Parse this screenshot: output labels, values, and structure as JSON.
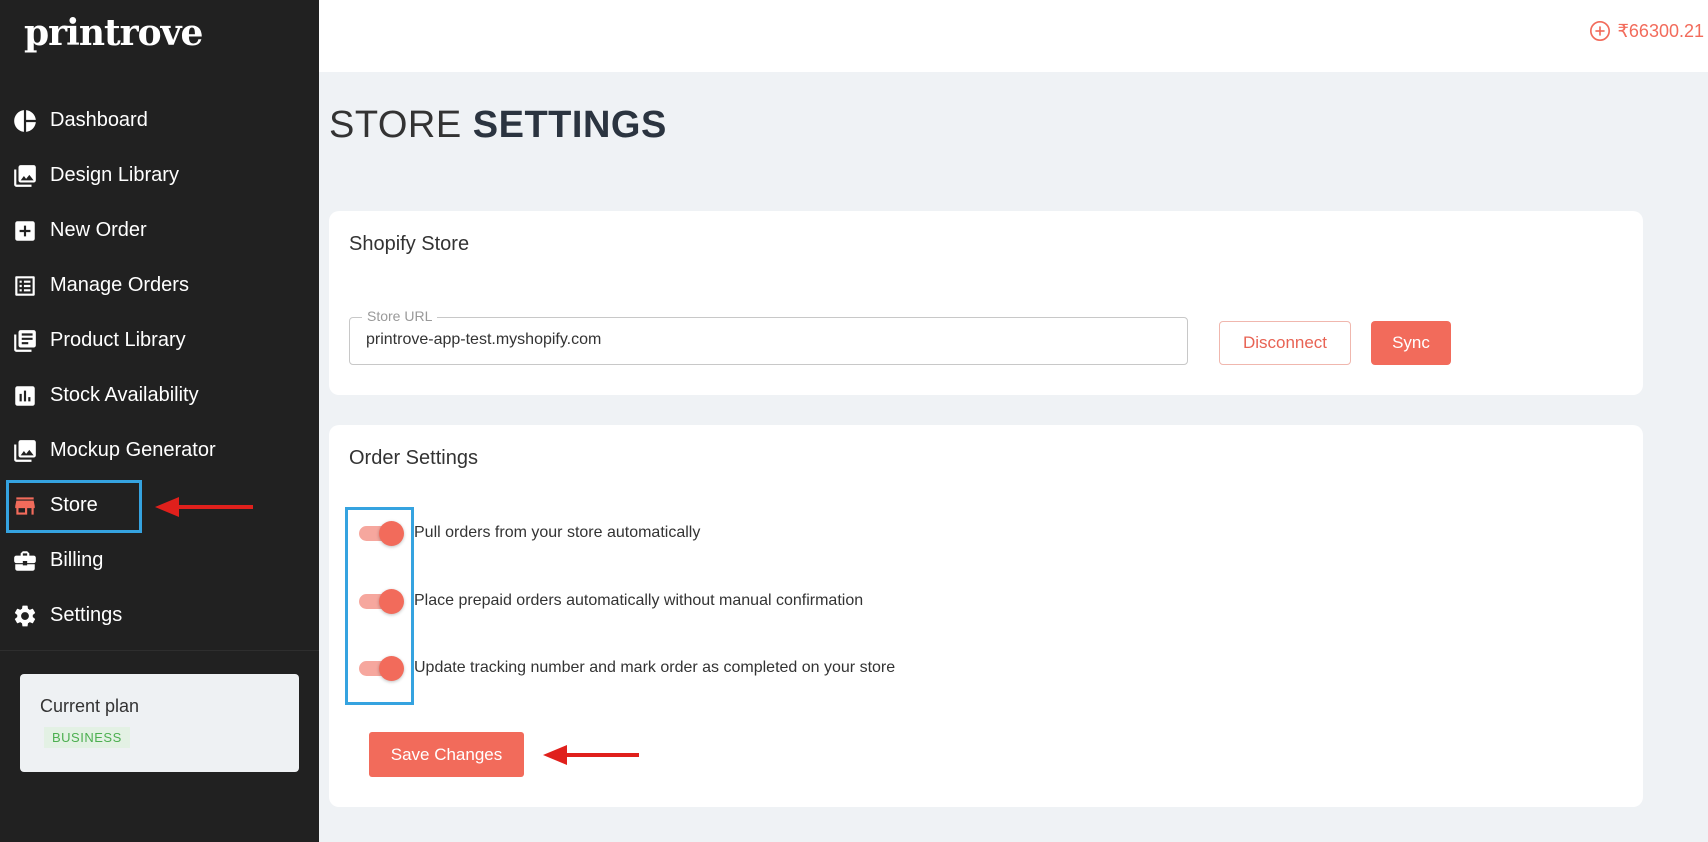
{
  "brand": {
    "logo_text": "printrove"
  },
  "sidebar": {
    "items": [
      {
        "label": "Dashboard",
        "icon": "pie-chart-icon"
      },
      {
        "label": "Design Library",
        "icon": "image-library-icon"
      },
      {
        "label": "New Order",
        "icon": "plus-square-icon"
      },
      {
        "label": "Manage Orders",
        "icon": "list-icon"
      },
      {
        "label": "Product Library",
        "icon": "book-icon"
      },
      {
        "label": "Stock Availability",
        "icon": "bar-chart-icon"
      },
      {
        "label": "Mockup Generator",
        "icon": "image-icon"
      },
      {
        "label": "Store",
        "icon": "storefront-icon",
        "active": true
      },
      {
        "label": "Billing",
        "icon": "briefcase-icon"
      },
      {
        "label": "Settings",
        "icon": "gear-icon"
      }
    ],
    "plan": {
      "label": "Current plan",
      "badge": "BUSINESS"
    }
  },
  "header": {
    "balance": "₹66300.21",
    "balance_icon": "add-circle-icon"
  },
  "page": {
    "title_light": "STORE",
    "title_bold": "SETTINGS"
  },
  "store_card": {
    "title": "Shopify Store",
    "url_label": "Store URL",
    "url_value": "printrove-app-test.myshopify.com",
    "disconnect_label": "Disconnect",
    "sync_label": "Sync"
  },
  "order_card": {
    "title": "Order Settings",
    "toggles": [
      {
        "label": "Pull orders from your store automatically",
        "on": true
      },
      {
        "label": "Place prepaid orders automatically without manual confirmation",
        "on": true
      },
      {
        "label": "Update tracking number and mark order as completed on your store",
        "on": true
      }
    ],
    "save_label": "Save Changes"
  },
  "colors": {
    "accent": "#f26b5b",
    "sidebar_bg": "#212121",
    "highlight": "#35a3e0",
    "annotation_arrow": "#e0201c"
  }
}
